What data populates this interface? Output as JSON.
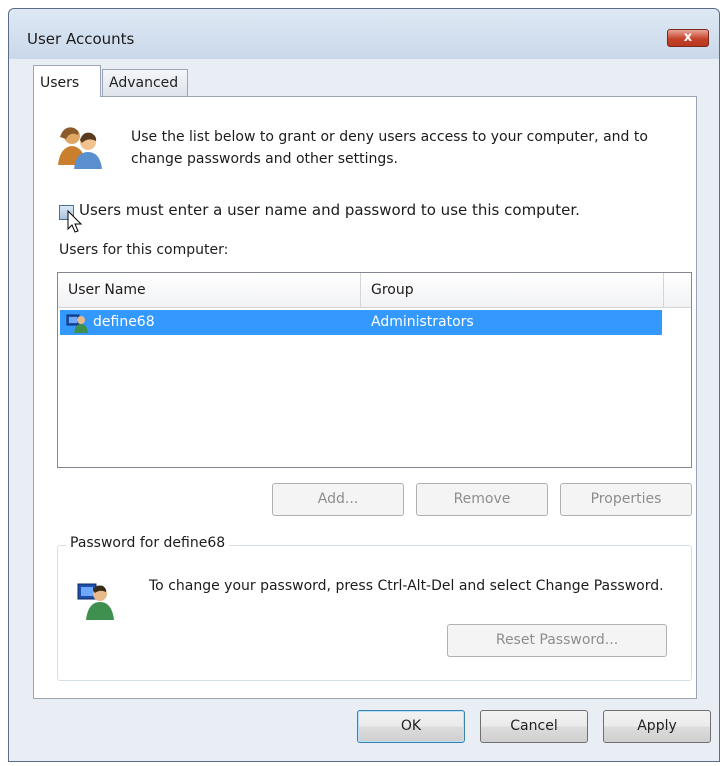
{
  "window": {
    "title": "User Accounts",
    "close_label": "x"
  },
  "tabs": [
    {
      "label": "Users"
    },
    {
      "label": "Advanced"
    }
  ],
  "intro": {
    "text": "Use the list below to grant or deny users access to your computer, and to change passwords and other settings."
  },
  "checkbox": {
    "label": "Users must enter a user name and password to use this computer.",
    "checked": false
  },
  "list": {
    "label": "Users for this computer:",
    "columns": [
      "User Name",
      "Group"
    ],
    "rows": [
      {
        "user": "define68",
        "group": "Administrators",
        "selected": true
      }
    ]
  },
  "buttons": {
    "add": "Add...",
    "remove": "Remove",
    "properties": "Properties"
  },
  "password": {
    "legend": "Password for define68",
    "text": "To change your password, press Ctrl-Alt-Del and select Change Password.",
    "reset": "Reset Password..."
  },
  "footer": {
    "ok": "OK",
    "cancel": "Cancel",
    "apply": "Apply"
  },
  "colors": {
    "selection": "#3399ff",
    "window_bg": "#e9eef5",
    "close": "#c6432b"
  }
}
